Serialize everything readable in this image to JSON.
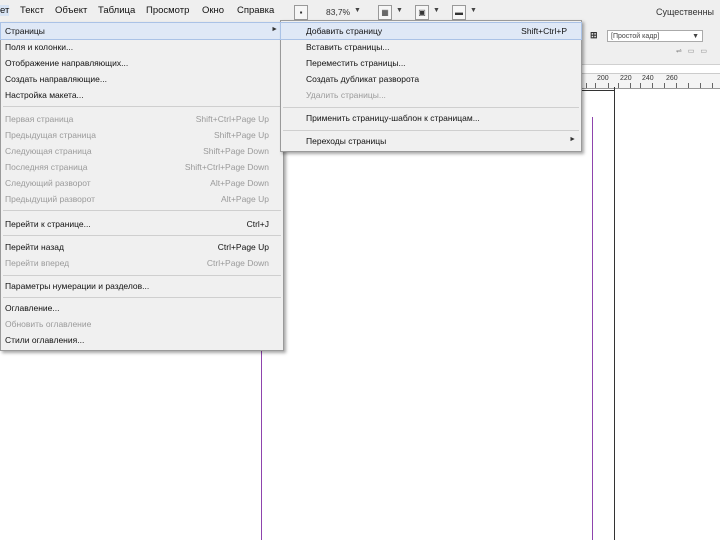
{
  "menubar": {
    "items": [
      {
        "label": "ет"
      },
      {
        "label": "Текст"
      },
      {
        "label": "Объект"
      },
      {
        "label": "Таблица"
      },
      {
        "label": "Просмотр"
      },
      {
        "label": "Окно"
      },
      {
        "label": "Справка"
      }
    ],
    "zoom": "83,7%",
    "workspace": "Существенны"
  },
  "style_panel": {
    "style_value": "[Простой кадр]"
  },
  "ruler": {
    "labels": [
      "200",
      "220",
      "240",
      "260"
    ]
  },
  "layout_menu": {
    "items": [
      {
        "label": "Страницы",
        "shortcut": "",
        "submenu": true,
        "disabled": false,
        "highlight": true
      },
      {
        "label": "Поля и колонки...",
        "shortcut": "",
        "disabled": false
      },
      {
        "label": "Отображение направляющих...",
        "shortcut": "",
        "disabled": false
      },
      {
        "label": "Создать направляющие...",
        "shortcut": "",
        "disabled": false
      },
      {
        "label": "Настройка макета...",
        "shortcut": "",
        "disabled": false
      },
      {
        "label": "Первая страница",
        "shortcut": "Shift+Ctrl+Page Up",
        "disabled": true
      },
      {
        "label": "Предыдущая страница",
        "shortcut": "Shift+Page Up",
        "disabled": true
      },
      {
        "label": "Следующая страница",
        "shortcut": "Shift+Page Down",
        "disabled": true
      },
      {
        "label": "Последняя страница",
        "shortcut": "Shift+Ctrl+Page Down",
        "disabled": true
      },
      {
        "label": "Следующий разворот",
        "shortcut": "Alt+Page Down",
        "disabled": true
      },
      {
        "label": "Предыдущий разворот",
        "shortcut": "Alt+Page Up",
        "disabled": true
      },
      {
        "label": "Перейти к странице...",
        "shortcut": "Ctrl+J",
        "disabled": false
      },
      {
        "label": "Перейти назад",
        "shortcut": "Ctrl+Page Up",
        "disabled": false
      },
      {
        "label": "Перейти вперед",
        "shortcut": "Ctrl+Page Down",
        "disabled": true
      },
      {
        "label": "Параметры нумерации и разделов...",
        "shortcut": "",
        "disabled": false
      },
      {
        "label": "Оглавление...",
        "shortcut": "",
        "disabled": false
      },
      {
        "label": "Обновить оглавление",
        "shortcut": "",
        "disabled": true
      },
      {
        "label": "Стили оглавления...",
        "shortcut": "",
        "disabled": false
      }
    ]
  },
  "pages_submenu": {
    "items": [
      {
        "label": "Добавить страницу",
        "shortcut": "Shift+Ctrl+P",
        "disabled": false,
        "highlight": true
      },
      {
        "label": "Вставить страницы...",
        "shortcut": "",
        "disabled": false
      },
      {
        "label": "Переместить страницы...",
        "shortcut": "",
        "disabled": false
      },
      {
        "label": "Создать дубликат разворота",
        "shortcut": "",
        "disabled": false
      },
      {
        "label": "Удалить страницы...",
        "shortcut": "",
        "disabled": true
      },
      {
        "label": "Применить страницу-шаблон к страницам...",
        "shortcut": "",
        "disabled": false
      },
      {
        "label": "Переходы страницы",
        "shortcut": "",
        "submenu": true,
        "disabled": false
      }
    ]
  }
}
